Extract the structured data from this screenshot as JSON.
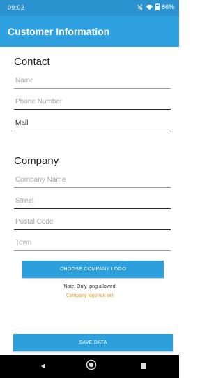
{
  "status_bar": {
    "time": "09:02",
    "battery": "66%",
    "icons": [
      "mute-icon",
      "wifi-icon",
      "battery-icon"
    ]
  },
  "app_bar": {
    "title": "Customer Information"
  },
  "contact": {
    "heading": "Contact",
    "name": {
      "placeholder": "Name",
      "value": ""
    },
    "phone": {
      "placeholder": "Phone Number",
      "value": ""
    },
    "mail": {
      "placeholder": "Mail",
      "value": "Mail"
    }
  },
  "company": {
    "heading": "Company",
    "company_name": {
      "placeholder": "Company Name",
      "value": ""
    },
    "street": {
      "placeholder": "Street",
      "value": ""
    },
    "postal_code": {
      "placeholder": "Postal Code",
      "value": ""
    },
    "town": {
      "placeholder": "Town",
      "value": ""
    },
    "choose_logo_label": "CHOOSE COMPANY LOGO",
    "note": "Note: Only .png allowed",
    "logo_status": "Company logo not set"
  },
  "save_label": "SAVE DATA",
  "nav": {
    "icons": [
      "back-icon",
      "home-icon",
      "recents-icon"
    ]
  },
  "colors": {
    "status_bar": "#2a93cf",
    "app_bar": "#2ea0e0",
    "button": "#2d9fdb",
    "warning_text": "#f09a1e"
  }
}
